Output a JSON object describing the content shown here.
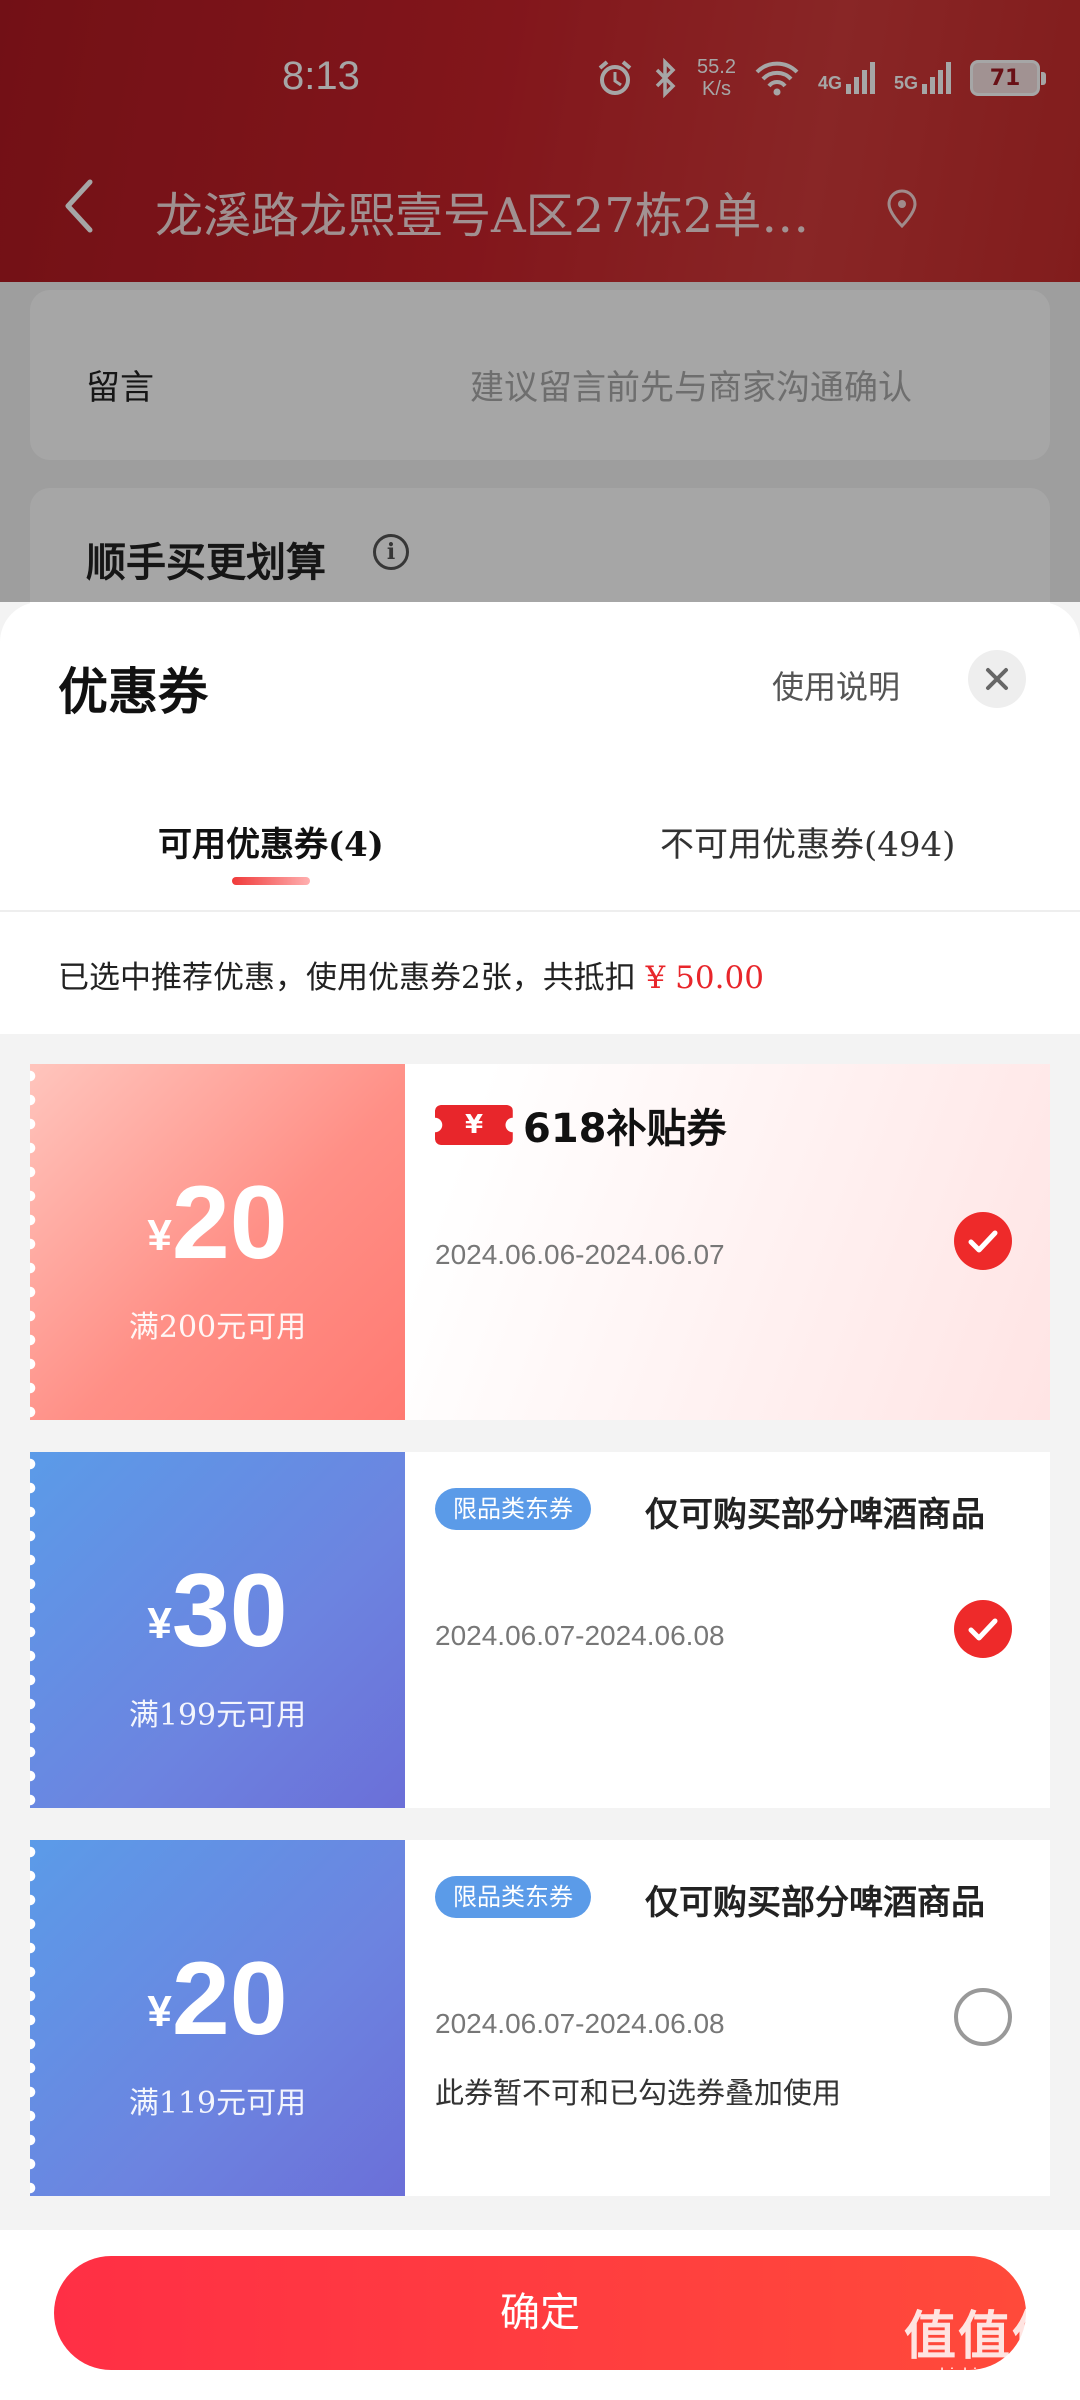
{
  "status_bar": {
    "time": "8:13",
    "net_speed_value": "55.2",
    "net_speed_unit": "K/s",
    "network_1": "4G",
    "network_2": "5G",
    "battery": "71"
  },
  "nav": {
    "address": "龙溪路龙熙壹号A区27栋2单…"
  },
  "order": {
    "remark_label": "留言",
    "remark_placeholder": "建议留言前先与商家沟通确认",
    "addon_title": "顺手买更划算",
    "info_glyph": "i"
  },
  "sheet": {
    "title": "优惠券",
    "usage_link": "使用说明",
    "close_glyph": "✕",
    "tabs": [
      {
        "label": "可用优惠券(4)",
        "active": true
      },
      {
        "label": "不可用优惠券(494)",
        "active": false
      }
    ],
    "summary_text": "已选中推荐优惠，使用优惠券2张，共抵扣",
    "summary_amount": "¥ 50.00",
    "confirm_label": "确定"
  },
  "coupons": [
    {
      "currency": "¥",
      "amount": "20",
      "threshold": "满200元可用",
      "badge_symbol": "¥",
      "badge_label": "618补贴券",
      "dates": "2024.06.06-2024.06.07",
      "checked": true
    },
    {
      "currency": "¥",
      "amount": "30",
      "threshold": "满199元可用",
      "category_badge": "限品类东券",
      "description": "仅可购买部分啤酒商品",
      "dates": "2024.06.07-2024.06.08",
      "checked": true
    },
    {
      "currency": "¥",
      "amount": "20",
      "threshold": "满119元可用",
      "category_badge": "限品类东券",
      "description": "仅可购买部分啤酒商品",
      "dates": "2024.06.07-2024.06.08",
      "note": "此券暂不可和已勾选券叠加使用",
      "checked": false
    }
  ],
  "watermark": {
    "logo": "值值值",
    "url": "zhizhizhi.com"
  },
  "colors": {
    "accent_red": "#e8262b",
    "header_red": "#c8222a",
    "coupon_blue": "#5b9be8"
  }
}
